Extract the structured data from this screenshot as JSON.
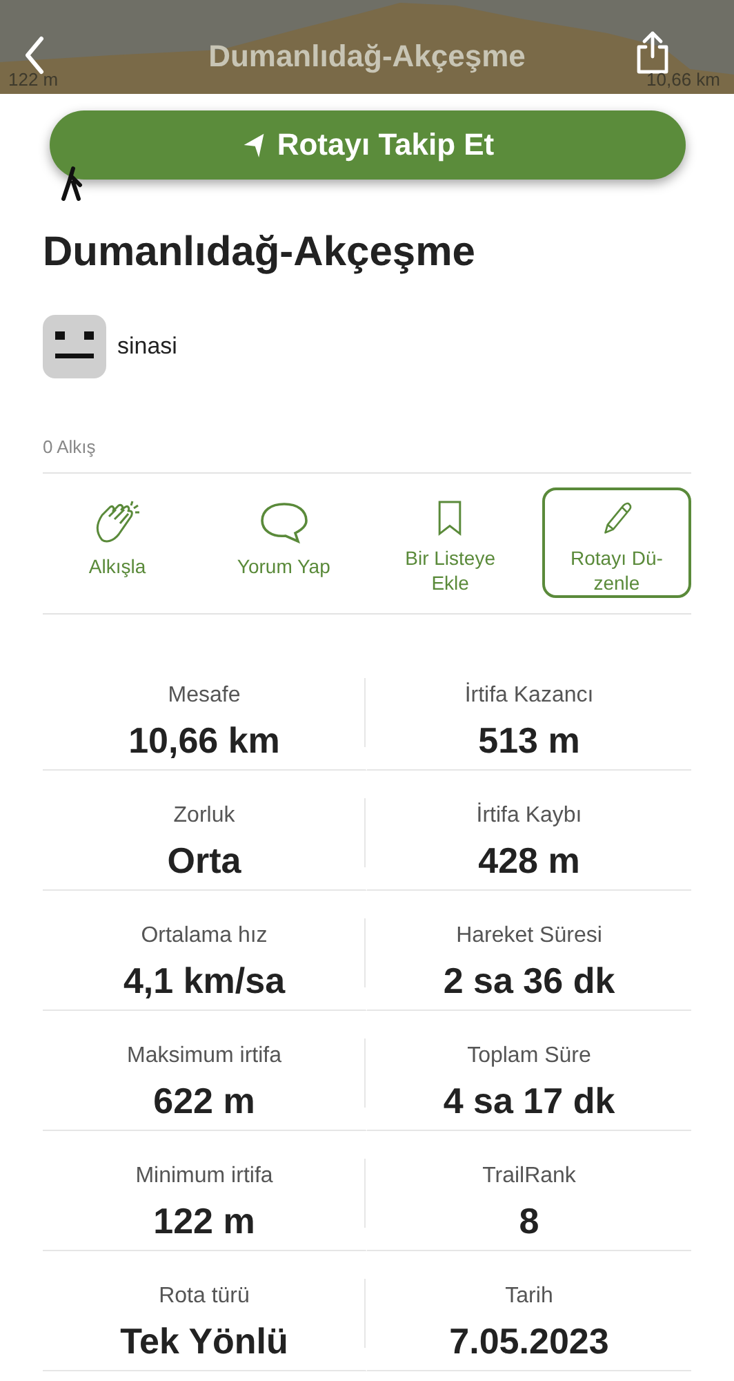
{
  "header": {
    "title": "Dumanlıdağ-Akçeşme",
    "profile_start": "122 m",
    "profile_end": "10,66 km"
  },
  "follow_button": {
    "label": "Rotayı Takip Et"
  },
  "route": {
    "title": "Dumanlıdağ-Akçeşme",
    "author": "sinasi",
    "claps": "0 Alkış"
  },
  "actions": [
    {
      "kind": "clap",
      "label": "Alkışla",
      "outlined": false
    },
    {
      "kind": "comment",
      "label": "Yorum Yap",
      "outlined": false
    },
    {
      "kind": "list",
      "label": "Bir Listeye Ekle",
      "outlined": false
    },
    {
      "kind": "edit",
      "label": "Rotayı Dü-zenle",
      "outlined": true
    }
  ],
  "stats": [
    {
      "label": "Mesafe",
      "value": "10,66 km"
    },
    {
      "label": "İrtifa Kazancı",
      "value": "513 m"
    },
    {
      "label": "Zorluk",
      "value": "Orta"
    },
    {
      "label": "İrtifa Kaybı",
      "value": "428 m"
    },
    {
      "label": "Ortalama hız",
      "value": "4,1 km/sa"
    },
    {
      "label": "Hareket Süresi",
      "value": "2 sa 36 dk"
    },
    {
      "label": "Maksimum irtifa",
      "value": "622 m"
    },
    {
      "label": "Toplam Süre",
      "value": "4 sa 17 dk"
    },
    {
      "label": "Minimum irtifa",
      "value": "122 m"
    },
    {
      "label": "TrailRank",
      "value": "8"
    },
    {
      "label": "Rota türü",
      "value": "Tek Yönlü"
    },
    {
      "label": "Tarih",
      "value": "7.05.2023"
    }
  ]
}
